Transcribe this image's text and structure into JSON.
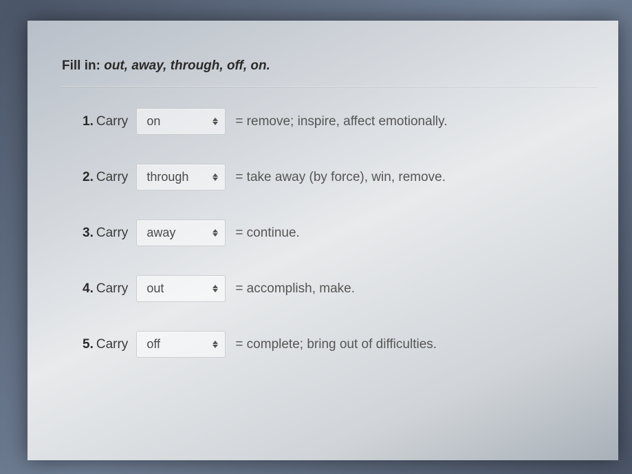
{
  "instruction": {
    "prefix": "Fill in:",
    "options": "out, away, through, off, on."
  },
  "questions": [
    {
      "number": "1.",
      "stem": "Carry",
      "selected": "on",
      "definition": "= remove; inspire, affect emotionally."
    },
    {
      "number": "2.",
      "stem": "Carry",
      "selected": "through",
      "definition": "= take away (by force), win, remove."
    },
    {
      "number": "3.",
      "stem": "Carry",
      "selected": "away",
      "definition": "= continue."
    },
    {
      "number": "4.",
      "stem": "Carry",
      "selected": "out",
      "definition": "= accomplish, make."
    },
    {
      "number": "5.",
      "stem": "Carry",
      "selected": "off",
      "definition": "= complete; bring out of difficulties."
    }
  ]
}
